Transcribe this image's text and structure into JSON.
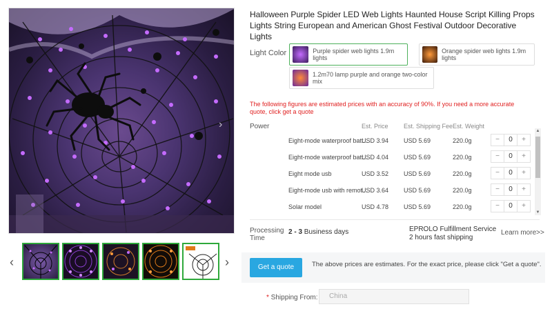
{
  "product": {
    "title": "Halloween Purple Spider LED Web Lights Haunted House Script Killing Props Lights String European and American Ghost Festival Outdoor Decorative Lights"
  },
  "gallery": {
    "prev_icon": "chevron-left-icon",
    "next_icon": "chevron-right-icon",
    "thumb_count": 5
  },
  "light_color": {
    "label": "Light Color",
    "options": [
      {
        "label": "Purple spider web lights 1.9m lights",
        "selected": true,
        "swatch": "#6b3aa0"
      },
      {
        "label": "Orange spider web lights 1.9m lights",
        "selected": false,
        "swatch": "#c2601a"
      },
      {
        "label": "1.2m70 lamp purple and orange two-color mix",
        "selected": false,
        "swatch": "#7a3a8a"
      }
    ]
  },
  "warning": "The following figures are estimated prices with an accuracy of 90%. If you need a more accurate quote, click get a quote",
  "table": {
    "headers": {
      "power": "Power",
      "price": "Est. Price",
      "shipping": "Est. Shipping Fee",
      "weight": "Est. Weight"
    },
    "rows": [
      {
        "name": "Eight-mode waterproof batt...",
        "price": "USD 3.94",
        "shipping": "USD 5.69",
        "weight": "220.0g",
        "qty": "0"
      },
      {
        "name": "Eight-mode waterproof batt...",
        "price": "USD 4.04",
        "shipping": "USD 5.69",
        "weight": "220.0g",
        "qty": "0"
      },
      {
        "name": "Eight mode usb",
        "price": "USD 3.52",
        "shipping": "USD 5.69",
        "weight": "220.0g",
        "qty": "0"
      },
      {
        "name": "Eight-mode usb with remot...",
        "price": "USD 3.64",
        "shipping": "USD 5.69",
        "weight": "220.0g",
        "qty": "0"
      },
      {
        "name": "Solar model",
        "price": "USD 4.78",
        "shipping": "USD 5.69",
        "weight": "220.0g",
        "qty": "0"
      }
    ],
    "minus": "−",
    "plus": "+"
  },
  "processing": {
    "label": "Processing Time",
    "days_bold": "2 - 3",
    "days_suffix": " Business days",
    "fulfillment_line1": "EPROLO Fulfillment Service",
    "fulfillment_line2": "2 hours fast shipping",
    "learn_more": "Learn more>>"
  },
  "quote": {
    "button": "Get a quote",
    "note": "The above prices are estimates. For the exact price, please click \"Get a quote\"."
  },
  "shipping_from": {
    "required_mark": "*",
    "label": " Shipping From:",
    "value": "China"
  },
  "colors": {
    "accent_green": "#2ea83a",
    "quote_blue": "#29a7e1",
    "warning_red": "#e02020"
  }
}
